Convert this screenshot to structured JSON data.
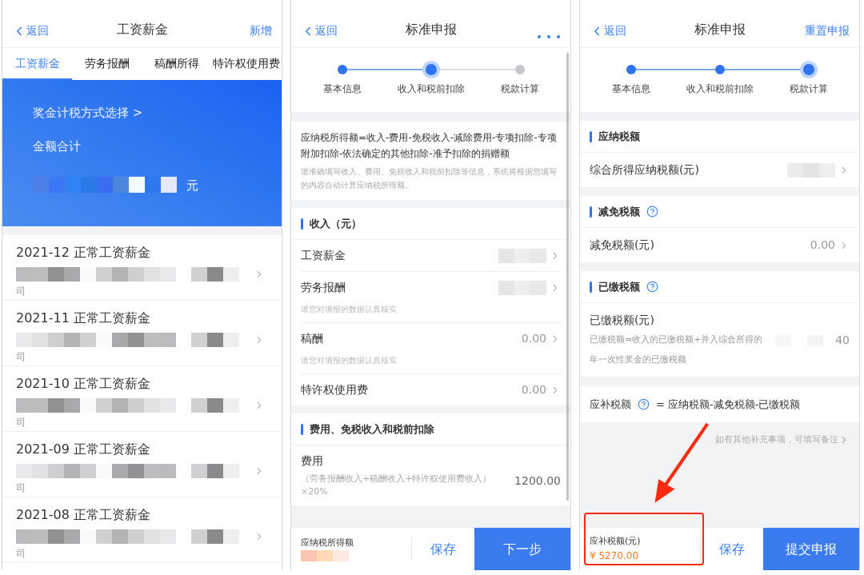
{
  "salary_screen": {
    "nav": {
      "back": "返回",
      "title": "工资薪金",
      "action": "新增"
    },
    "tabs": [
      {
        "label": "工资薪金",
        "selected": true
      },
      {
        "label": "劳务报酬",
        "selected": false
      },
      {
        "label": "稿酬所得",
        "selected": false
      },
      {
        "label": "特许权使用费",
        "selected": false
      }
    ],
    "banner": {
      "link": "奖金计税方式选择 >",
      "label": "金额合计",
      "unit": "元"
    },
    "records": [
      {
        "title": "2021-12 正常工资薪金",
        "suffix": "司"
      },
      {
        "title": "2021-11 正常工资薪金",
        "suffix": "司"
      },
      {
        "title": "2021-10 正常工资薪金",
        "suffix": "司"
      },
      {
        "title": "2021-09 正常工资薪金",
        "suffix": "司"
      },
      {
        "title": "2021-08 正常工资薪金",
        "suffix": "司"
      }
    ]
  },
  "income_screen": {
    "nav": {
      "back": "返回",
      "title": "标准申报"
    },
    "steps": [
      {
        "label": "基本信息",
        "done": true,
        "current": false
      },
      {
        "label": "收入和税前扣除",
        "done": true,
        "current": true
      },
      {
        "label": "税款计算",
        "done": false,
        "current": false
      }
    ],
    "formula": "应纳税所得额=收入-费用-免税收入-减除费用-专项扣除-专项附加扣除-依法确定的其他扣除-准予扣除的捐赠额",
    "note": "请准确填写收入、费用、免税收入和税前扣除等信息，系统将根据您填写的内容自动计算应纳税所得额。",
    "sections": [
      {
        "title": "收入（元）",
        "items": [
          {
            "label": "工资薪金"
          },
          {
            "label": "劳务报酬",
            "hint": "请您对填报的数据认真核实"
          },
          {
            "label": "稿酬",
            "value": "0.00",
            "hint": "请您对填报的数据认真核实"
          },
          {
            "label": "特许权使用费",
            "value": "0.00"
          }
        ]
      },
      {
        "title": "费用、免税收入和税前扣除",
        "items": [
          {
            "label": "费用",
            "desc": "（劳务报酬收入+稿酬收入+特许权使用费收入）×20%",
            "value": "1200.00"
          }
        ]
      }
    ],
    "footer": {
      "label": "应纳税所得额",
      "save": "保存",
      "primary": "下一步"
    }
  },
  "tax_screen": {
    "nav": {
      "back": "返回",
      "title": "标准申报",
      "action": "重置申报"
    },
    "steps": [
      {
        "label": "基本信息",
        "done": true,
        "current": false
      },
      {
        "label": "收入和税前扣除",
        "done": true,
        "current": false
      },
      {
        "label": "税款计算",
        "done": true,
        "current": true
      }
    ],
    "sections": [
      {
        "title": "应纳税额",
        "help": false,
        "items": [
          {
            "label": "综合所得应纳税额(元)"
          }
        ]
      },
      {
        "title": "减免税额",
        "help": true,
        "items": [
          {
            "label": "减免税额(元)",
            "value": "0.00"
          }
        ]
      },
      {
        "title": "已缴税额",
        "help": true,
        "items": [
          {
            "label": "已缴税额(元)",
            "desc": "已缴税额=收入的已缴税额+并入综合所得的",
            "desc_2": "年一次性奖金的已缴税额",
            "value": "40"
          }
        ]
      }
    ],
    "formula": {
      "label": "应补税额",
      "expression": "= 应纳税额-减免税额-已缴税额"
    },
    "remark": "如有其他补充事项，可填写备注",
    "footer": {
      "label": "应补税额(元)",
      "value": "¥ 5270.00",
      "save": "保存",
      "primary": "提交申报"
    }
  }
}
